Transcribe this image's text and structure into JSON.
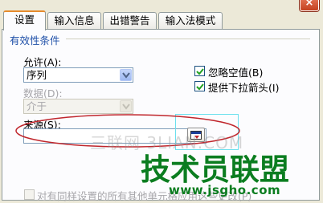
{
  "window": {
    "close_symbol": "×"
  },
  "tabs": [
    {
      "label": "设置",
      "active": true
    },
    {
      "label": "输入信息",
      "active": false
    },
    {
      "label": "出错警告",
      "active": false
    },
    {
      "label": "输入法模式",
      "active": false
    }
  ],
  "validity": {
    "group_title": "有效性条件",
    "allow": {
      "label": "允许(A):",
      "value": "序列"
    },
    "data": {
      "label": "数据(D):",
      "value": "介于",
      "disabled": true
    },
    "ignore_blank": {
      "label": "忽略空值(B)",
      "checked": true
    },
    "dropdown": {
      "label": "提供下拉箭头(I)",
      "checked": true
    },
    "source": {
      "label": "来源(S):",
      "value": ""
    },
    "apply_all": {
      "label": "对有同样设置的所有其他单元格应用这些更改(P)",
      "disabled": true
    }
  },
  "watermarks": {
    "text1": "三联网 3LIAN.COM",
    "brand": "技术员联盟",
    "url": "www.jsgho.com"
  },
  "icons": {
    "close": "close-icon",
    "dropdown": "chevron-down-icon",
    "checkmark": "checkmark-icon",
    "range_select": "range-select-icon"
  },
  "colors": {
    "dialog_bg": "#ece9d8",
    "panel_bg": "#fcfcfe",
    "group_title": "#1e4fa8",
    "annotation_red": "#c0262c",
    "highlight_cyan": "#6ce0ee",
    "brand_green": "#0b7d20"
  }
}
